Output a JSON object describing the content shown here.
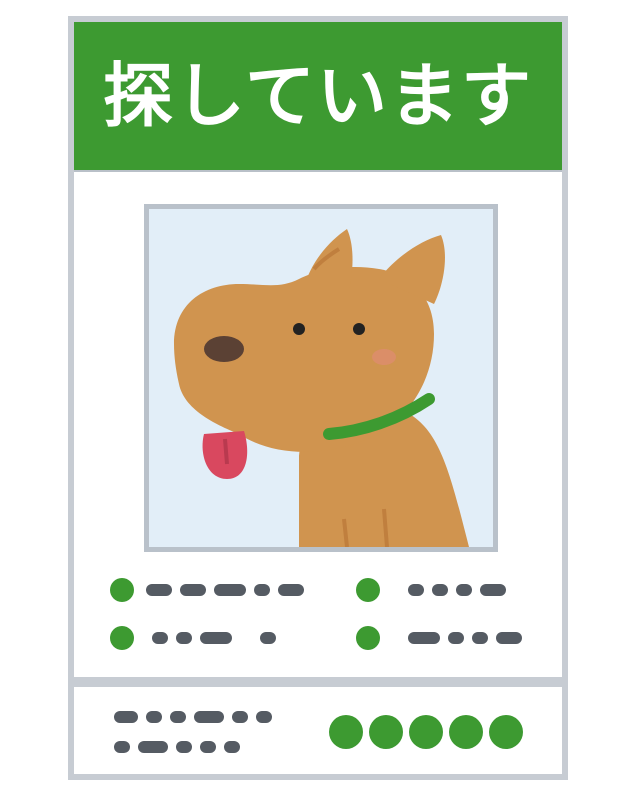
{
  "poster": {
    "title": "探しています"
  },
  "colors": {
    "header_green": "#3d9a31",
    "border_gray": "#c7ccd3",
    "photo_bg": "#e2eef8",
    "dog_body": "#d0944f",
    "collar_green": "#3d9a31",
    "tongue_red": "#d9485f",
    "text_bar_gray": "#555b63",
    "bullet_green": "#3d9a31"
  },
  "icons": {
    "photo": "dog-icon",
    "bullets": "green-dot-icon",
    "text_placeholder": "text-dash-icon"
  },
  "rating_dots": 5
}
